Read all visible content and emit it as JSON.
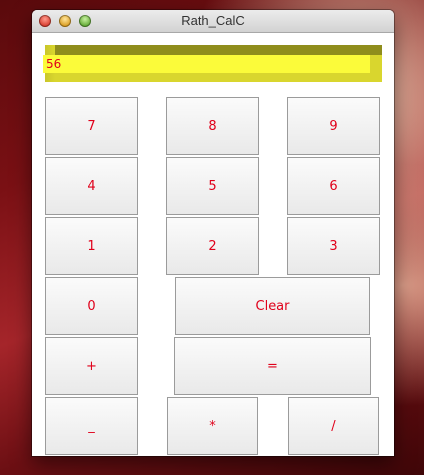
{
  "window": {
    "title": "Rath_CalC"
  },
  "display": {
    "value": "56"
  },
  "keys": {
    "seven": "7",
    "eight": "8",
    "nine": "9",
    "four": "4",
    "five": "5",
    "six": "6",
    "one": "1",
    "two": "2",
    "three": "3",
    "zero": "0",
    "clear": "Clear",
    "plus": "+",
    "equals": "=",
    "minus": "_",
    "multiply": "*",
    "divide": "/"
  },
  "colors": {
    "display_bg": "#fbfb3a",
    "display_frame": "#d9d62e",
    "key_text": "#e0001a"
  }
}
